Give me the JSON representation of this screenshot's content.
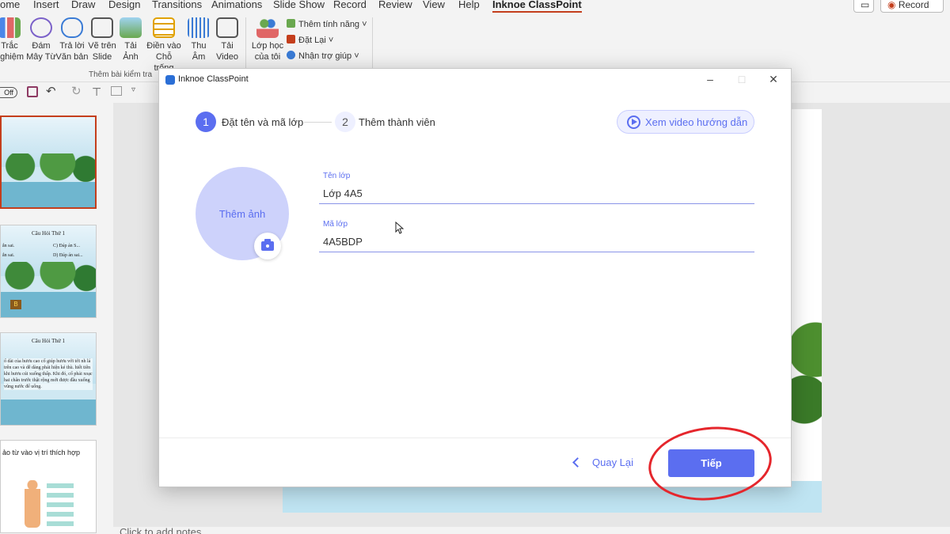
{
  "menu": {
    "items": [
      "ome",
      "Insert",
      "Draw",
      "Design",
      "Transitions",
      "Animations",
      "Slide Show",
      "Record",
      "Review",
      "View",
      "Help"
    ],
    "active_tab": "Inknoe ClassPoint",
    "record_label": "Record"
  },
  "ribbon": {
    "buttons": [
      {
        "l1": "Trắc",
        "l2": "nghiệm"
      },
      {
        "l1": "Đám",
        "l2": "Mây Từ"
      },
      {
        "l1": "Trả lời",
        "l2": "Văn bản"
      },
      {
        "l1": "Vẽ trên",
        "l2": "Slide"
      },
      {
        "l1": "Tải",
        "l2": "Ảnh"
      },
      {
        "l1": "Điền vào",
        "l2": "Chỗ trống"
      },
      {
        "l1": "Thu",
        "l2": "Âm"
      },
      {
        "l1": "Tải",
        "l2": "Video"
      },
      {
        "l1": "Lớp học",
        "l2": "của tôi"
      }
    ],
    "group_label": "Thêm bài kiểm tra",
    "small_commands": [
      "Thêm tính năng ˅",
      "Đặt Lại ˅",
      "Nhận trợ giúp ˅"
    ]
  },
  "qat": {
    "toggle_label": "Off"
  },
  "thumbnails": {
    "slide2_title": "Câu Hỏi Thứ 1",
    "slide2_a": "ắn sai.",
    "slide2_c": "C) Đáp án S...",
    "slide2_d": "D) Đáp án sai...",
    "slide2_b": "ắn sai.",
    "slide2_badge": "B",
    "slide3_title": "Câu Hỏi Thứ 1",
    "slide3_text": "ổ dài của hươu cao cổ giúp hươu với tới nh lá trên cao và dễ dàng phát hiện kẻ thù. hiết tiên khi hươu cúi xuống thấp. Khi đó, cổ phải xoạc hai chân trước thật rộng mới được đầu xuống vũng nước để uống.",
    "slide4_title": "ảo từ vào vị trí thích hợp"
  },
  "notes_placeholder": "Click to add notes",
  "dialog": {
    "title": "Inknoe ClassPoint",
    "step1_num": "1",
    "step1_label": "Đặt tên và mã lớp",
    "step2_num": "2",
    "step2_label": "Thêm thành viên",
    "video_label": "Xem video hướng dẫn",
    "avatar_label": "Thêm ảnh",
    "class_name_label": "Tên lớp",
    "class_name_value": "Lớp 4A5",
    "class_code_label": "Mã lớp",
    "class_code_value": "4A5BDP",
    "back_label": "Quay Lại",
    "next_label": "Tiếp"
  },
  "colors": {
    "accent": "#5b6ef0",
    "avatar_bg": "#cdd2fb",
    "tab_active": "#c43e1c",
    "annotation": "#e5262c"
  }
}
